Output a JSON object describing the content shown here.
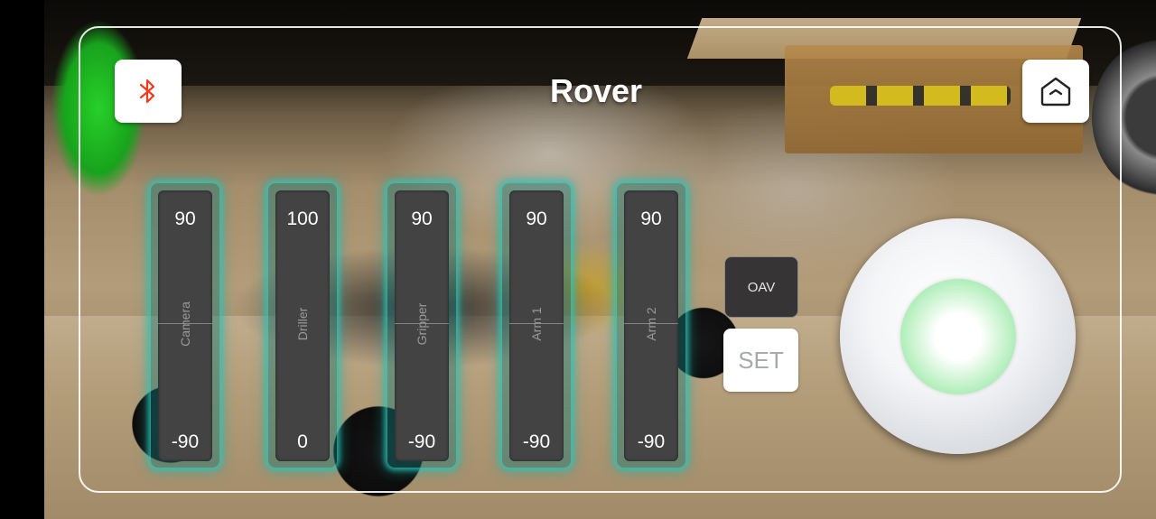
{
  "header": {
    "title": "Rover"
  },
  "icons": {
    "bluetooth": "bluetooth-icon",
    "home": "home-icon"
  },
  "colors": {
    "bluetooth_icon": "#f23a1e",
    "slider_glow": "#2ec9bc",
    "joystick_knob": "#a7ecb2"
  },
  "sliders": [
    {
      "label": "Camera",
      "max": "90",
      "min": "-90"
    },
    {
      "label": "Driller",
      "max": "100",
      "min": "0"
    },
    {
      "label": "Gripper",
      "max": "90",
      "min": "-90"
    },
    {
      "label": "Arm 1",
      "max": "90",
      "min": "-90"
    },
    {
      "label": "Arm 2",
      "max": "90",
      "min": "-90"
    }
  ],
  "controls": {
    "oav_label": "OAV",
    "set_label": "SET"
  }
}
